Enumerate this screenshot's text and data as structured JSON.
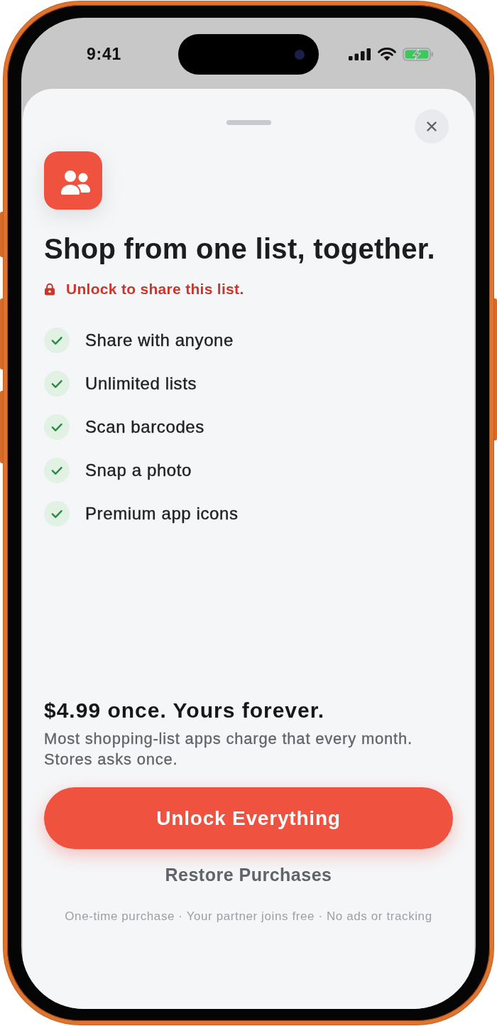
{
  "status_bar": {
    "time": "9:41",
    "charging": true
  },
  "sheet": {
    "title": "Shop from one list, together.",
    "notice": "Unlock to share this list.",
    "features": [
      {
        "label": "Share with anyone"
      },
      {
        "label": "Unlimited lists"
      },
      {
        "label": "Scan barcodes"
      },
      {
        "label": "Snap a photo"
      },
      {
        "label": "Premium app icons"
      }
    ],
    "price": "$4.99 once. Yours forever.",
    "price_note": "Most shopping-list apps charge that every month. Stores asks once.",
    "primary_button": "Unlock Everything",
    "secondary_button": "Restore Purchases",
    "footer": "One-time purchase · Your partner joins free · No ads or tracking"
  }
}
